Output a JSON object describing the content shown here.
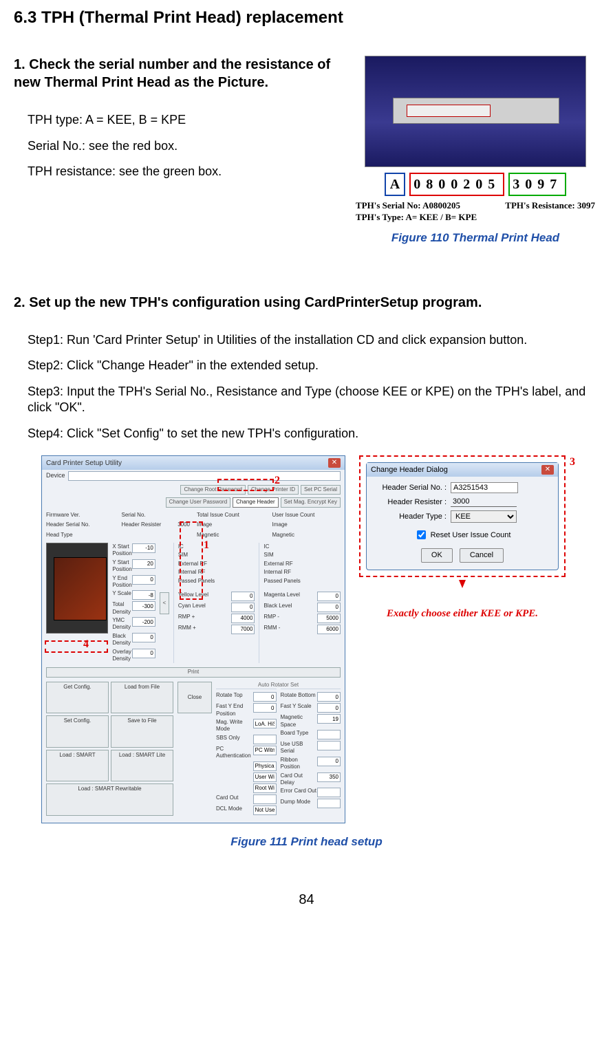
{
  "section_title": "6.3 TPH (Thermal Print Head) replacement",
  "step1": {
    "heading": "1.    Check the serial number and the resistance of new Thermal Print Head as the Picture.",
    "line_type": "TPH type: A = KEE, B = KPE",
    "line_serial": "Serial No.: see the red box.",
    "line_resist": "TPH resistance: see the green box.",
    "label_type_char": "A",
    "label_serial_digits": "0800205",
    "label_resist_digits": "3097",
    "legend_serial": "TPH's Serial No: A0800205",
    "legend_resist": "TPH's Resistance: 3097",
    "legend_type": "TPH's Type: A= KEE / B= KPE",
    "caption": "Figure 110 Thermal Print Head"
  },
  "step2": {
    "heading": "2.   Set up the new TPH's configuration using CardPrinterSetup program.",
    "s1": "Step1: Run 'Card Printer Setup' in Utilities of the installation CD and click expansion button.",
    "s2": "Step2: Click \"Change Header\" in the extended setup.",
    "s3": "Step3: Input the TPH's Serial No., Resistance and Type (choose KEE or KPE) on the TPH's label, and click \"OK\".",
    "s4": "Step4: Click \"Set Config\" to set the new TPH's configuration.",
    "caption": "Figure 111 Print head setup"
  },
  "setup_window": {
    "title": "Card Printer Setup Utility",
    "device_label": "Device",
    "top_buttons_row1": [
      "Change Root Password",
      "Change Printer ID",
      "Set PC Serial"
    ],
    "top_buttons_row2": [
      "Change User Password",
      "Change Header",
      "Set Mag. Encrypt Key"
    ],
    "readouts": {
      "firmware": "Firmware Ver.",
      "serial": "Serial No.",
      "total_issue": "Total Issue Count",
      "user_issue": "User Issue Count",
      "header_serial": "Header Serial No.",
      "header_resist": "Header Resister",
      "header_resist_val": "3000",
      "image": "Image",
      "head_type": "Head Type",
      "magnetic": "Magnetic",
      "ic": "IC",
      "sim": "SIM",
      "external_rf": "External RF",
      "internal_rf": "Internal RF",
      "passed_panels": "Passed Panels"
    },
    "params_left": [
      {
        "name": "X Start Position",
        "val": "-10"
      },
      {
        "name": "Y Start Position",
        "val": "20"
      },
      {
        "name": "Y End Position",
        "val": "0"
      },
      {
        "name": "Y Scale",
        "val": "-8"
      },
      {
        "name": "Total Density",
        "val": "-300"
      },
      {
        "name": "YMC Density",
        "val": "-200"
      },
      {
        "name": "Black Density",
        "val": "0"
      },
      {
        "name": "Overlay Density",
        "val": "0"
      }
    ],
    "params_mid": [
      {
        "name": "Yellow Level",
        "val": "0"
      },
      {
        "name": "Cyan Level",
        "val": "0"
      },
      {
        "name": "RMP +",
        "val": "4000"
      },
      {
        "name": "RMM +",
        "val": "7000"
      }
    ],
    "params_mid_right": [
      {
        "name": "Magenta Level",
        "val": "0"
      },
      {
        "name": "Black Level",
        "val": "0"
      },
      {
        "name": "RMP -",
        "val": "5000"
      },
      {
        "name": "RMM -",
        "val": "6000"
      }
    ],
    "rotator_label": "Auto Rotator Set",
    "params_bottom_left": [
      {
        "name": "Rotate Top",
        "val": "0"
      },
      {
        "name": "Fast Y End Position",
        "val": "0"
      },
      {
        "name": "Mag. Write Mode",
        "val": "LoA. HiS"
      },
      {
        "name": "SBS Only",
        "val": ""
      },
      {
        "name": "PC Authentication",
        "val": "PC Witness"
      },
      {
        "name": "",
        "val": "Physical Key"
      },
      {
        "name": "",
        "val": "User Witness"
      },
      {
        "name": "",
        "val": "Root Witness"
      },
      {
        "name": "Card Out",
        "val": ""
      },
      {
        "name": "DCL Mode",
        "val": "Not Use"
      }
    ],
    "params_bottom_right": [
      {
        "name": "Rotate Bottom",
        "val": "0"
      },
      {
        "name": "Fast Y Scale",
        "val": "0"
      },
      {
        "name": "Magnetic Space",
        "val": "19"
      },
      {
        "name": "Board Type",
        "val": ""
      },
      {
        "name": "Use USB Serial",
        "val": ""
      },
      {
        "name": "Ribbon Position",
        "val": "0"
      },
      {
        "name": "Card Out Delay",
        "val": "350"
      },
      {
        "name": "Error Card Out",
        "val": ""
      },
      {
        "name": "Dump Mode",
        "val": ""
      }
    ],
    "print_btn": "Print",
    "expand_btn": "<",
    "bottom_buttons": [
      "Get Config.",
      "Load from File",
      "Set Config.",
      "Save to File",
      "Load : SMART",
      "Load : SMART Lite",
      "Load : SMART Rewritable"
    ],
    "close_btn": "Close",
    "callouts": {
      "c1": "1",
      "c2": "2",
      "c3": "3",
      "c4": "4"
    }
  },
  "dialog": {
    "title": "Change Header Dialog",
    "serial_label": "Header Serial No. :",
    "serial_val": "A3251543",
    "resist_label": "Header Resister :",
    "resist_val": "3000",
    "type_label": "Header Type :",
    "type_val": "KEE",
    "type_options": [
      "KEE",
      "KPE"
    ],
    "reset_label": "Reset User Issue Count",
    "ok": "OK",
    "cancel": "Cancel",
    "caption": "Exactly choose either KEE or KPE."
  },
  "page_number": "84"
}
